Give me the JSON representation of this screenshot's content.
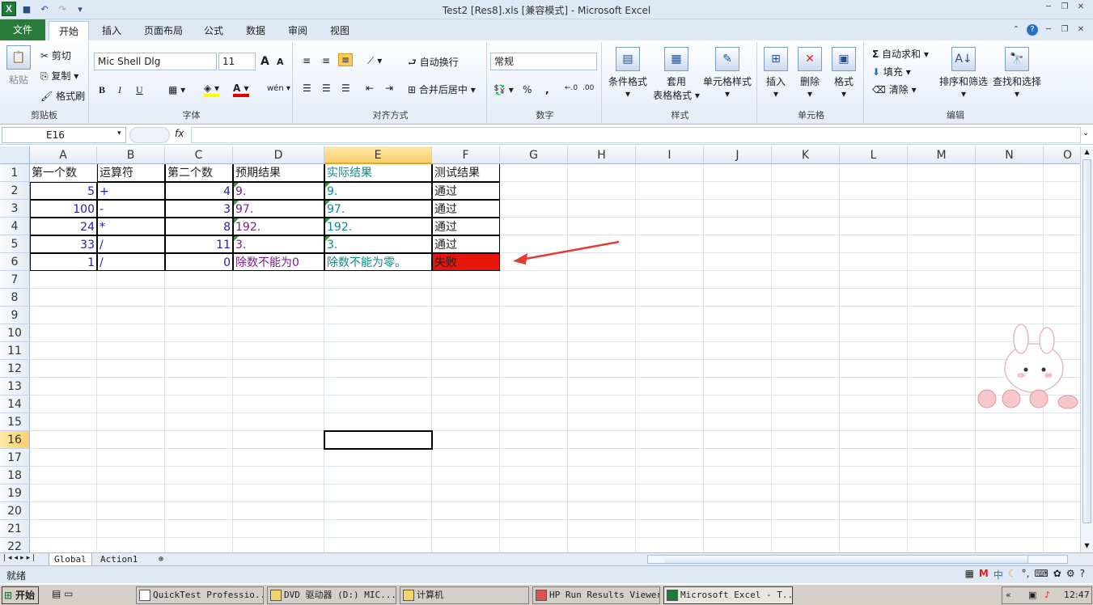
{
  "window": {
    "title": "Test2 [Res8].xls  [兼容模式]  -  Microsoft Excel",
    "app_icon": "X"
  },
  "tabs": [
    "文件",
    "开始",
    "插入",
    "页面布局",
    "公式",
    "数据",
    "审阅",
    "视图"
  ],
  "ribbon": {
    "clipboard": {
      "paste": "粘贴",
      "cut": "剪切",
      "copy": "复制",
      "format_painter": "格式刷",
      "label": "剪贴板"
    },
    "font": {
      "name": "Mic Shell Dlg",
      "size": "11",
      "bold": "B",
      "italic": "I",
      "underline": "U",
      "label": "字体",
      "grow": "A",
      "shrink": "A",
      "color": "A",
      "phonetic": "wén"
    },
    "alignment": {
      "wrap": "自动换行",
      "merge": "合并后居中",
      "label": "对齐方式"
    },
    "number": {
      "format": "常规",
      "label": "数字",
      "percent": "%",
      "comma": ","
    },
    "styles": {
      "conditional": "条件格式",
      "table1": "套用",
      "table2": "表格格式",
      "cell_styles": "单元格样式",
      "label": "样式"
    },
    "cells": {
      "insert": "插入",
      "delete": "删除",
      "format": "格式",
      "label": "单元格"
    },
    "editing": {
      "autosum": "自动求和",
      "fill": "填充",
      "clear": "清除",
      "sort": "排序和筛选",
      "find": "查找和选择",
      "label": "编辑",
      "sigma": "Σ"
    }
  },
  "formula_bar": {
    "name_box": "E16",
    "fx": "fx",
    "content": ""
  },
  "columns": [
    "A",
    "B",
    "C",
    "D",
    "E",
    "F",
    "G",
    "H",
    "I",
    "J",
    "K",
    "L",
    "M",
    "N",
    "O"
  ],
  "rows": [
    "1",
    "2",
    "3",
    "4",
    "5",
    "6",
    "7",
    "8",
    "9",
    "10",
    "11",
    "12",
    "13",
    "14",
    "15",
    "16",
    "17",
    "18",
    "19",
    "20",
    "21",
    "22"
  ],
  "table": {
    "headers": [
      "第一个数",
      "运算符",
      "第二个数",
      "预期结果",
      "实际结果",
      "测试结果"
    ],
    "data": [
      [
        "5",
        "+",
        "4",
        "9.",
        "9.",
        "通过"
      ],
      [
        "100",
        "-",
        "3",
        "97.",
        "97.",
        "通过"
      ],
      [
        "24",
        "*",
        "8",
        "192.",
        "192.",
        "通过"
      ],
      [
        "33",
        "/",
        "11",
        "3.",
        "3.",
        "通过"
      ],
      [
        "1",
        "/",
        "0",
        "除数不能为0",
        "除数不能为零。",
        "失败"
      ]
    ]
  },
  "colors": {
    "fail": "#e8150b",
    "arrow": "#e63b30",
    "accent_file_tab": "#2a7a3b"
  },
  "sheets": [
    "Global",
    "Action1"
  ],
  "status": {
    "ready": "就绪"
  },
  "taskbar": {
    "start": "开始",
    "items": [
      "QuickTest Professio...",
      "DVD 驱动器 (D:) MIC...",
      "计算机",
      "HP Run Results Viewer",
      "Microsoft Excel - T..."
    ],
    "clock": "12:47",
    "chevron": "«"
  }
}
